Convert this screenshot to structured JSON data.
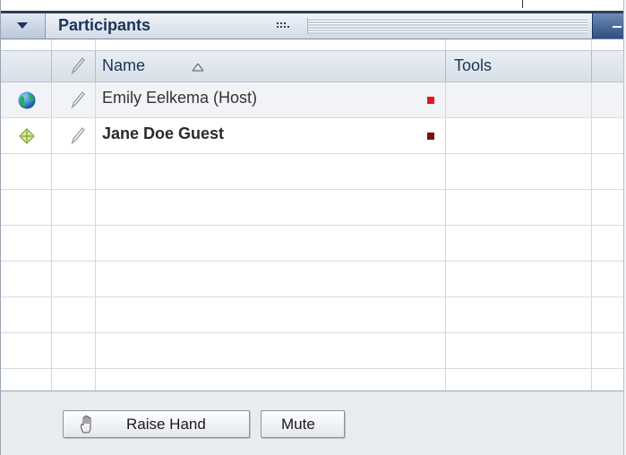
{
  "window": {
    "title": "Participants"
  },
  "table": {
    "columns": {
      "name": "Name",
      "tools": "Tools"
    },
    "rows": [
      {
        "name": "Emily Eelkema (Host)",
        "status_color": "#e8141c"
      },
      {
        "name": "Jane Doe Guest",
        "status_color": "#7a0f12"
      }
    ]
  },
  "footer": {
    "raise_hand_label": "Raise Hand",
    "mute_label": "Mute"
  },
  "icons": {
    "title_menu": "chevron-down-icon",
    "grip": "grip-icon",
    "minimize": "minimize-icon",
    "pencil": "pencil-icon",
    "sort": "sort-ascending-icon",
    "host_role": "globe-icon",
    "guest_role": "diamond-icon",
    "raise_hand": "hand-icon"
  },
  "colors": {
    "title_text": "#1b3358",
    "title_border": "#2c3e55",
    "minimize_button": "#2e4e7f"
  }
}
